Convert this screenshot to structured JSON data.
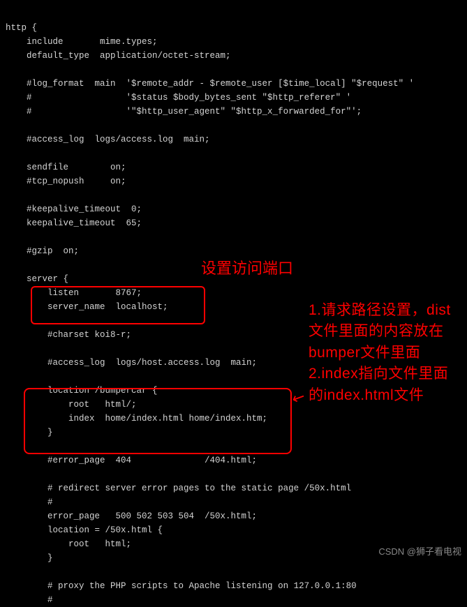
{
  "code": {
    "l01": "http {",
    "l02": "    include       mime.types;",
    "l03": "    default_type  application/octet-stream;",
    "l04": "",
    "l05": "    #log_format  main  '$remote_addr - $remote_user [$time_local] \"$request\" '",
    "l06": "    #                  '$status $body_bytes_sent \"$http_referer\" '",
    "l07": "    #                  '\"$http_user_agent\" \"$http_x_forwarded_for\"';",
    "l08": "",
    "l09": "    #access_log  logs/access.log  main;",
    "l10": "",
    "l11": "    sendfile        on;",
    "l12": "    #tcp_nopush     on;",
    "l13": "",
    "l14": "    #keepalive_timeout  0;",
    "l15": "    keepalive_timeout  65;",
    "l16": "",
    "l17": "    #gzip  on;",
    "l18": "",
    "l19": "    server {",
    "l20": "        listen       8767;",
    "l21": "        server_name  localhost;",
    "l22": "",
    "l23": "        #charset koi8-r;",
    "l24": "",
    "l25": "        #access_log  logs/host.access.log  main;",
    "l26": "",
    "l27": "        location /bumpercar {",
    "l28": "            root   html/;",
    "l29": "            index  home/index.html home/index.htm;",
    "l30": "        }",
    "l31": "",
    "l32": "        #error_page  404              /404.html;",
    "l33": "",
    "l34": "        # redirect server error pages to the static page /50x.html",
    "l35": "        #",
    "l36": "        error_page   500 502 503 504  /50x.html;",
    "l37": "        location = /50x.html {",
    "l38": "            root   html;",
    "l39": "        }",
    "l40": "",
    "l41": "        # proxy the PHP scripts to Apache listening on 127.0.0.1:80",
    "l42": "        #"
  },
  "annot": {
    "port_title": "设置访问端口",
    "location_desc": "1.请求路径设置，dist文件里面的内容放在bumper文件里面\n2.index指向文件里面的index.html文件"
  },
  "watermark": "CSDN @狮子看电视"
}
